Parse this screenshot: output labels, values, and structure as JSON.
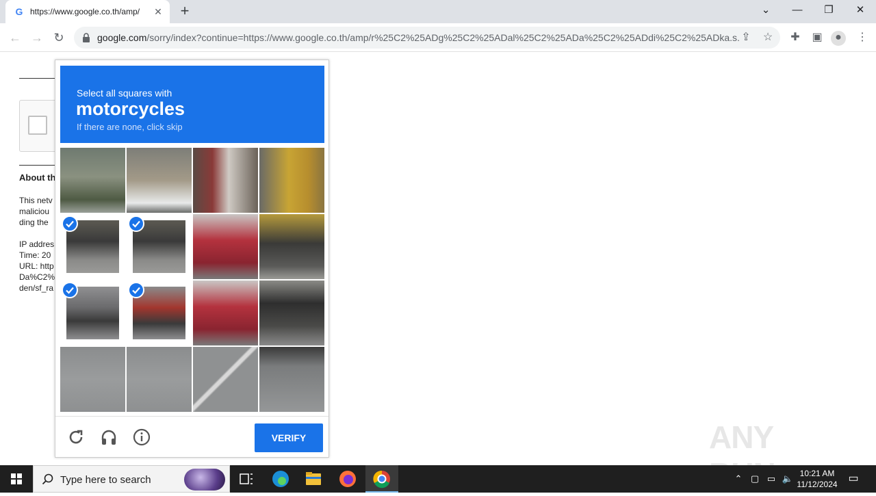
{
  "browser": {
    "tab_title": "https://www.google.co.th/amp/",
    "url_domain": "google.com",
    "url_rest": "/sorry/index?continue=https://www.google.co.th/amp/r%25C2%25ADg%25C2%25ADal%25C2%25ADa%25C2%25ADdi%25C2%25ADka.s..."
  },
  "page": {
    "heading_partial": "About th",
    "text_lines": [
      "This netv",
      "maliciou",
      "ding the",
      "IP addres",
      "Time: 20",
      "URL: http",
      "Da%C2%",
      "den/sf_ra"
    ]
  },
  "captcha": {
    "instruction_line1": "Select all squares with",
    "target": "motorcycles",
    "instruction_line3": "If there are none, click skip",
    "verify_label": "VERIFY",
    "tiles": [
      {
        "id": 1,
        "selected": false,
        "scene": "storefront"
      },
      {
        "id": 2,
        "selected": false,
        "scene": "storefront-car"
      },
      {
        "id": 3,
        "selected": false,
        "scene": "storefront-red"
      },
      {
        "id": 4,
        "selected": false,
        "scene": "storefront-yellow"
      },
      {
        "id": 5,
        "selected": true,
        "scene": "motorcycle-rider"
      },
      {
        "id": 6,
        "selected": true,
        "scene": "motorcycle-rider"
      },
      {
        "id": 7,
        "selected": false,
        "scene": "red-car"
      },
      {
        "id": 8,
        "selected": false,
        "scene": "motorcycles-parked"
      },
      {
        "id": 9,
        "selected": true,
        "scene": "motorcycle-wheel"
      },
      {
        "id": 10,
        "selected": true,
        "scene": "motorcycle-wheel-red"
      },
      {
        "id": 11,
        "selected": false,
        "scene": "red-car"
      },
      {
        "id": 12,
        "selected": false,
        "scene": "tuk-tuk"
      },
      {
        "id": 13,
        "selected": false,
        "scene": "road"
      },
      {
        "id": 14,
        "selected": false,
        "scene": "road"
      },
      {
        "id": 15,
        "selected": false,
        "scene": "road-line"
      },
      {
        "id": 16,
        "selected": false,
        "scene": "road-wheel"
      }
    ]
  },
  "watermark": "ANY RUN",
  "taskbar": {
    "search_placeholder": "Type here to search",
    "time": "10:21 AM",
    "date": "11/12/2024"
  },
  "colors": {
    "accent": "#1a73e8",
    "taskbar": "#1f1f1f"
  }
}
